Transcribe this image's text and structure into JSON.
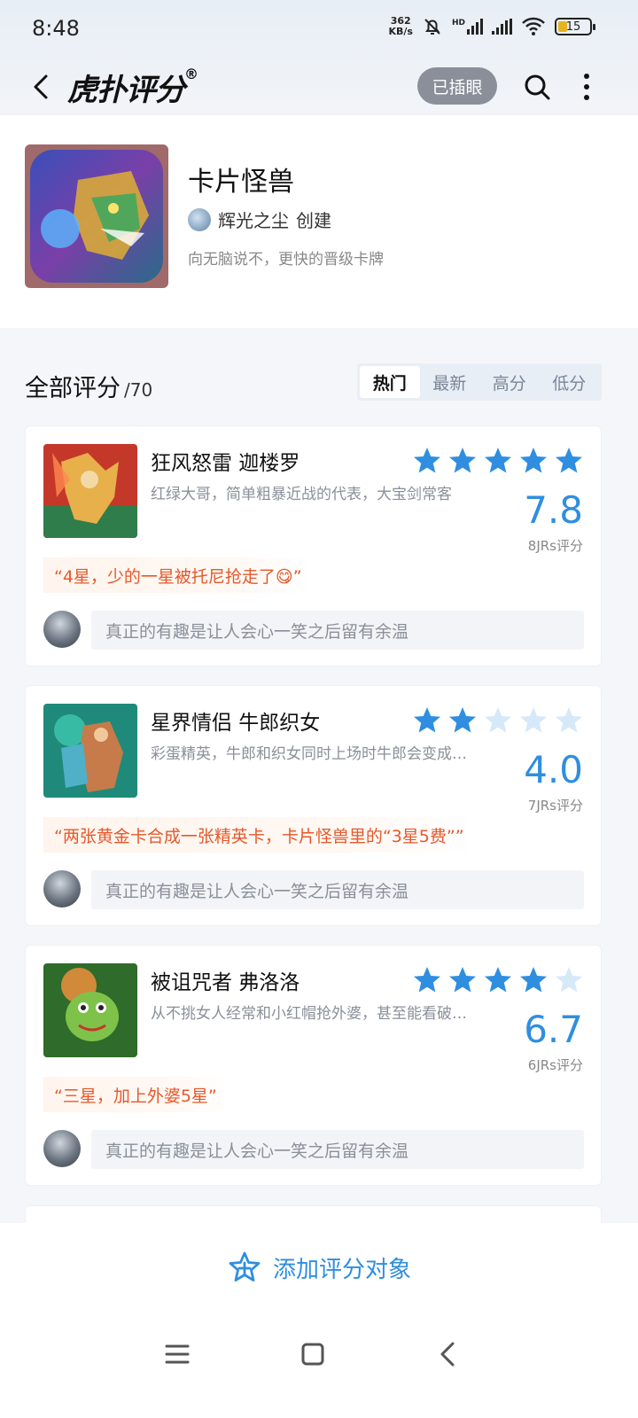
{
  "status_bar": {
    "time": "8:48",
    "net_speed_value": "362",
    "net_speed_unit": "KB/s",
    "hd_label": "HD",
    "battery": "15"
  },
  "nav": {
    "logo_text": "虎扑评分",
    "logo_mark": "®",
    "pin_label": "已插眼"
  },
  "header": {
    "title": "卡片怪兽",
    "creator_name": "辉光之尘",
    "creator_action": "创建",
    "subtitle": "向无脑说不，更快的晋级卡牌"
  },
  "section": {
    "title": "全部评分",
    "count": "/70",
    "sort_tabs": [
      "热门",
      "最新",
      "高分",
      "低分"
    ],
    "active_tab": "热门"
  },
  "items": [
    {
      "name": "狂风怒雷 迦楼罗",
      "desc": "红绿大哥，简单粗暴近战的代表，大宝剑常客",
      "stars_filled": 5,
      "score": "7.8",
      "count": "8JRs评分",
      "quote": "“4星，少的一星被托尼抢走了😋”",
      "reply_placeholder": "真正的有趣是让人会心一笑之后留有余温"
    },
    {
      "name": "星界情侣 牛郎织女",
      "desc": "彩蛋精英，牛郎和织女同时上场时牛郎会变成…",
      "stars_filled": 2,
      "score": "4.0",
      "count": "7JRs评分",
      "quote": "“两张黄金卡合成一张精英卡，卡片怪兽里的“3星5费””",
      "reply_placeholder": "真正的有趣是让人会心一笑之后留有余温"
    },
    {
      "name": "被诅咒者 弗洛洛",
      "desc": "从不挑女人经常和小红帽抢外婆，甚至能看破…",
      "stars_filled": 4,
      "score": "6.7",
      "count": "6JRs评分",
      "quote": "“三星，加上外婆5星”",
      "reply_placeholder": "真正的有趣是让人会心一笑之后留有余温"
    }
  ],
  "bottom": {
    "add_label": "添加评分对象"
  },
  "colors": {
    "accent": "#2f8ee0",
    "star_filled": "#2f8ee0",
    "star_empty": "#d6e9f9",
    "quote_text": "#e5582b"
  }
}
